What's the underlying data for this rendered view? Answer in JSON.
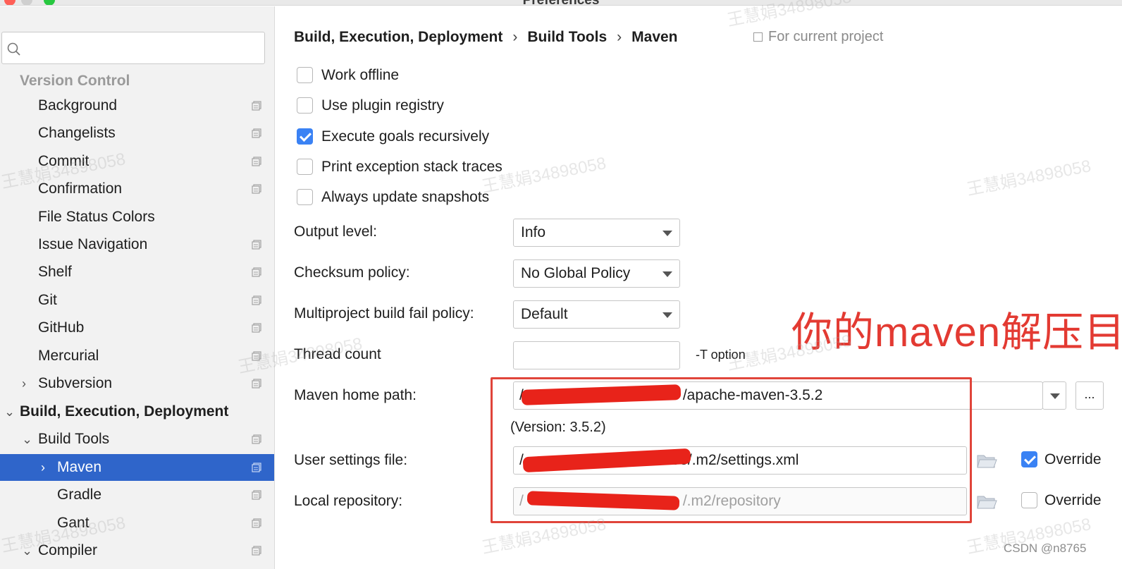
{
  "window": {
    "title": "Preferences"
  },
  "sidebar": {
    "search_placeholder": "",
    "items": [
      {
        "label": "Version Control",
        "kind": "section"
      },
      {
        "label": "Background"
      },
      {
        "label": "Changelists"
      },
      {
        "label": "Commit"
      },
      {
        "label": "Confirmation"
      },
      {
        "label": "File Status Colors"
      },
      {
        "label": "Issue Navigation"
      },
      {
        "label": "Shelf"
      },
      {
        "label": "Git"
      },
      {
        "label": "GitHub"
      },
      {
        "label": "Mercurial"
      },
      {
        "label": "Subversion"
      },
      {
        "label": "Build, Execution, Deployment"
      },
      {
        "label": "Build Tools"
      },
      {
        "label": "Maven",
        "selected": true
      },
      {
        "label": "Gradle"
      },
      {
        "label": "Gant"
      },
      {
        "label": "Compiler"
      }
    ]
  },
  "breadcrumb": [
    "Build, Execution, Deployment",
    "Build Tools",
    "Maven"
  ],
  "breadcrumb_sep": "›",
  "scope_label": "For current project",
  "options": [
    {
      "label": "Work offline",
      "checked": false
    },
    {
      "label": "Use plugin registry",
      "checked": false
    },
    {
      "label": "Execute goals recursively",
      "checked": true
    },
    {
      "label": "Print exception stack traces",
      "checked": false
    },
    {
      "label": "Always update snapshots",
      "checked": false
    }
  ],
  "fields": {
    "output_level": {
      "label": "Output level:",
      "value": "Info"
    },
    "checksum_policy": {
      "label": "Checksum policy:",
      "value": "No Global Policy"
    },
    "multiproject_fail_policy": {
      "label": "Multiproject build fail policy:",
      "value": "Default"
    },
    "thread_count": {
      "label": "Thread count",
      "value": "",
      "hint": "-T option"
    },
    "maven_home": {
      "label": "Maven home path:",
      "value_prefix": "/",
      "value_suffix": "/apache-maven-3.5.2",
      "version": "(Version: 3.5.2)",
      "more_label": "..."
    },
    "user_settings": {
      "label": "User settings file:",
      "value_prefix": "/",
      "value_suffix": "n03/.m2/settings.xml",
      "override_label": "Override",
      "override_checked": true
    },
    "local_repo": {
      "label": "Local repository:",
      "value_prefix": "/",
      "value_suffix": "/.m2/repository",
      "override_label": "Override",
      "override_checked": false
    }
  },
  "annotation": {
    "text": "你的maven解压目",
    "color": "#e33a32"
  },
  "watermarks": [
    "王慧娟34898058",
    "王慧娟34898058",
    "王慧娟34898058",
    "王慧娟34898058",
    "王慧娟34898058",
    "王慧娟34898058",
    "王慧娟34898058",
    "王慧娟34898058",
    "王慧娟34898058"
  ],
  "footer_credit": "CSDN @n8765",
  "colors": {
    "selection": "#2f65ca",
    "checkbox": "#3a82f4",
    "annotation": "#e33a32"
  }
}
